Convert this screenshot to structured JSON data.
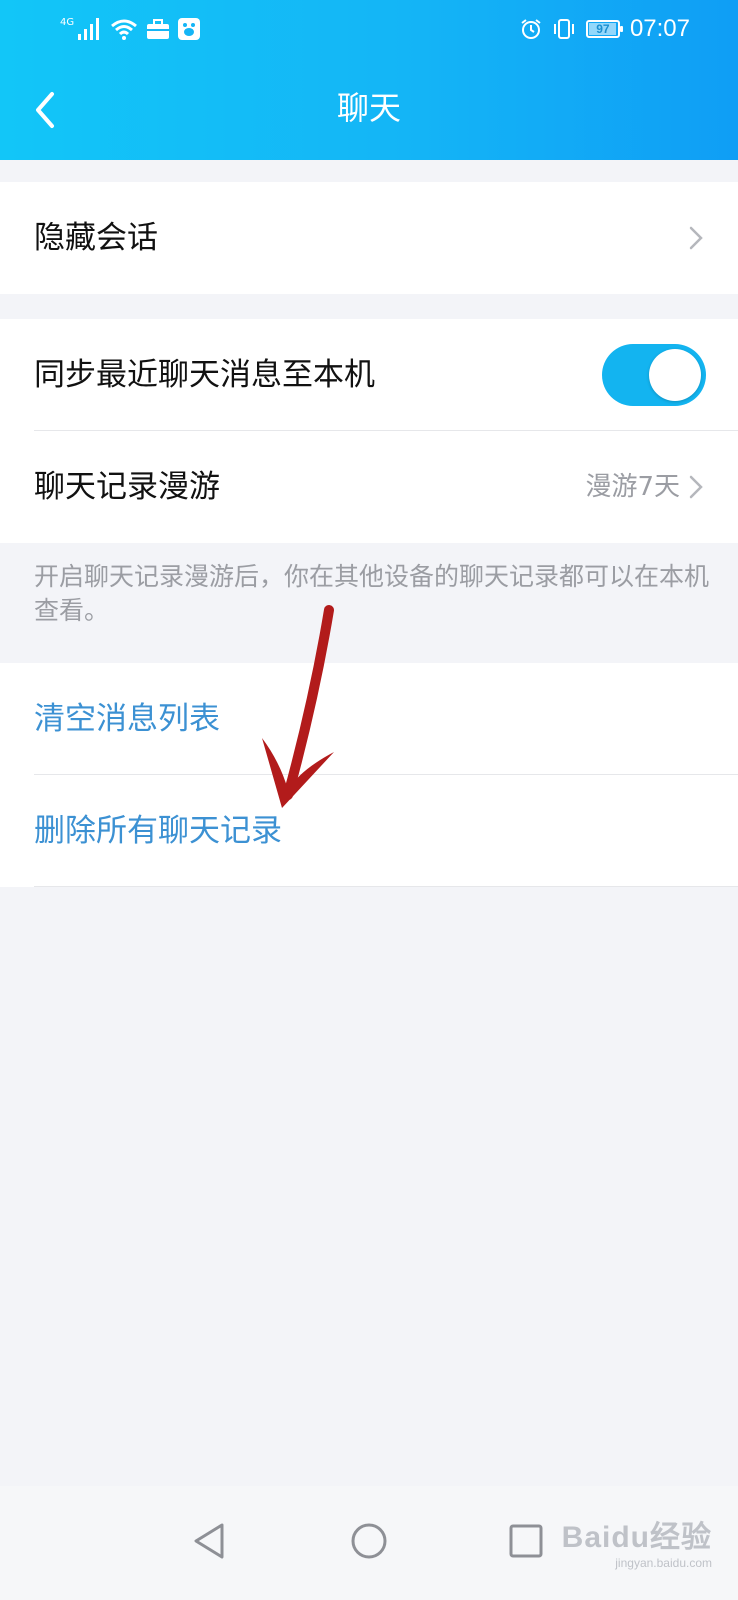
{
  "status_bar": {
    "network": "4G",
    "battery": "97",
    "battery_level": 0.97,
    "time": "07:07"
  },
  "header": {
    "title": "聊天",
    "back_icon": "chevron-left-icon"
  },
  "settings": {
    "hidden_chats": {
      "label": "隐藏会话"
    },
    "sync_recent": {
      "label": "同步最近聊天消息至本机",
      "enabled": true
    },
    "roaming": {
      "label": "聊天记录漫游",
      "value": "漫游7天"
    },
    "roaming_hint": "开启聊天记录漫游后，你在其他设备的聊天记录都可以在本机查看。",
    "clear_list": {
      "label": "清空消息列表"
    },
    "delete_all": {
      "label": "删除所有聊天记录"
    }
  },
  "colors": {
    "header_start": "#12c6f8",
    "header_end": "#0f9ef5",
    "toggle_on": "#13b4f0",
    "action_blue": "#3c91d3",
    "annotation_arrow": "#b21b1b"
  },
  "navigation": {
    "back": "triangle-back-icon",
    "home": "circle-home-icon",
    "recents": "square-recents-icon"
  },
  "watermark": {
    "main": "Baidu经验",
    "sub": "jingyan.baidu.com"
  }
}
